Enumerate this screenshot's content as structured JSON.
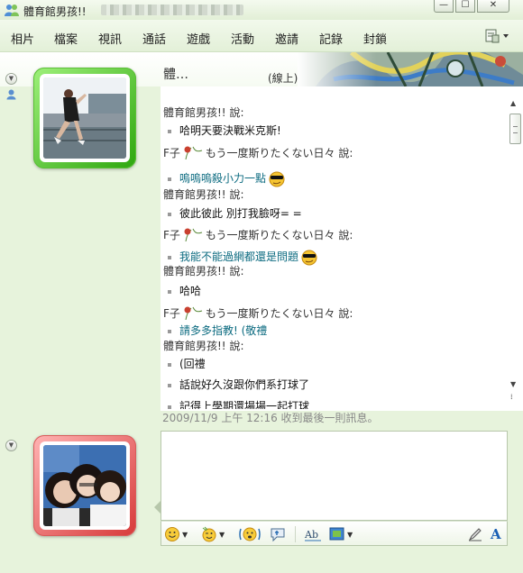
{
  "window": {
    "title": "體育館男孩!!",
    "min_symbol": "—",
    "max_symbol": "☐",
    "close_symbol": "✕"
  },
  "menu": {
    "items": [
      "相片",
      "檔案",
      "視訊",
      "通話",
      "遊戲",
      "活動",
      "邀請",
      "記錄",
      "封鎖"
    ]
  },
  "contact": {
    "name": "體…",
    "status": "(線上)"
  },
  "conversation": {
    "lines": [
      {
        "kind": "speaker",
        "name": "體育館男孩!!",
        "says": "說:"
      },
      {
        "kind": "msg",
        "text": "哈明天要決戰米克斯!"
      },
      {
        "kind": "speaker_flower",
        "name_pre": "F子",
        "name_post": "もう一度斯りたくない日々",
        "says": "說:"
      },
      {
        "kind": "msg_teal",
        "text": "嗚嗚嗚殺小力一點",
        "emoticon": "cool-face"
      },
      {
        "kind": "speaker",
        "name": "體育館男孩!!",
        "says": "說:"
      },
      {
        "kind": "msg",
        "text": "彼此彼此 別打我臉呀= ="
      },
      {
        "kind": "speaker_flower",
        "name_pre": "F子",
        "name_post": "もう一度斯りたくない日々",
        "says": "說:"
      },
      {
        "kind": "msg_teal",
        "text": "我能不能過網都還是問題",
        "emoticon": "cool-face"
      },
      {
        "kind": "speaker",
        "name": "體育館男孩!!",
        "says": "說:"
      },
      {
        "kind": "msg",
        "text": "哈哈"
      },
      {
        "kind": "speaker_flower",
        "name_pre": "F子",
        "name_post": "もう一度斯りたくない日々",
        "says": "說:"
      },
      {
        "kind": "msg_teal",
        "text": "請多多指教! (敬禮"
      },
      {
        "kind": "speaker",
        "name": "體育館男孩!!",
        "says": "說:"
      },
      {
        "kind": "msg",
        "text": "(回禮"
      },
      {
        "kind": "msg",
        "text": "話說好久沒跟你們系打球了"
      },
      {
        "kind": "msg",
        "text": "記得上學期還場場一起打球"
      }
    ],
    "last_received": "2009/11/9 上午 12:16 收到最後一則訊息。"
  },
  "toolbar": {
    "buttons": [
      "emoticon-button",
      "wink-button",
      "nudge-button",
      "voice-clip-button",
      "font-button",
      "background-button",
      "handwriting-button",
      "format-text-button"
    ],
    "format_label": "A"
  },
  "colors": {
    "background": "#e7f3dc",
    "teal_message": "#0c6b80",
    "online_frame": "#2ea60e",
    "self_frame": "#d73a3a"
  }
}
